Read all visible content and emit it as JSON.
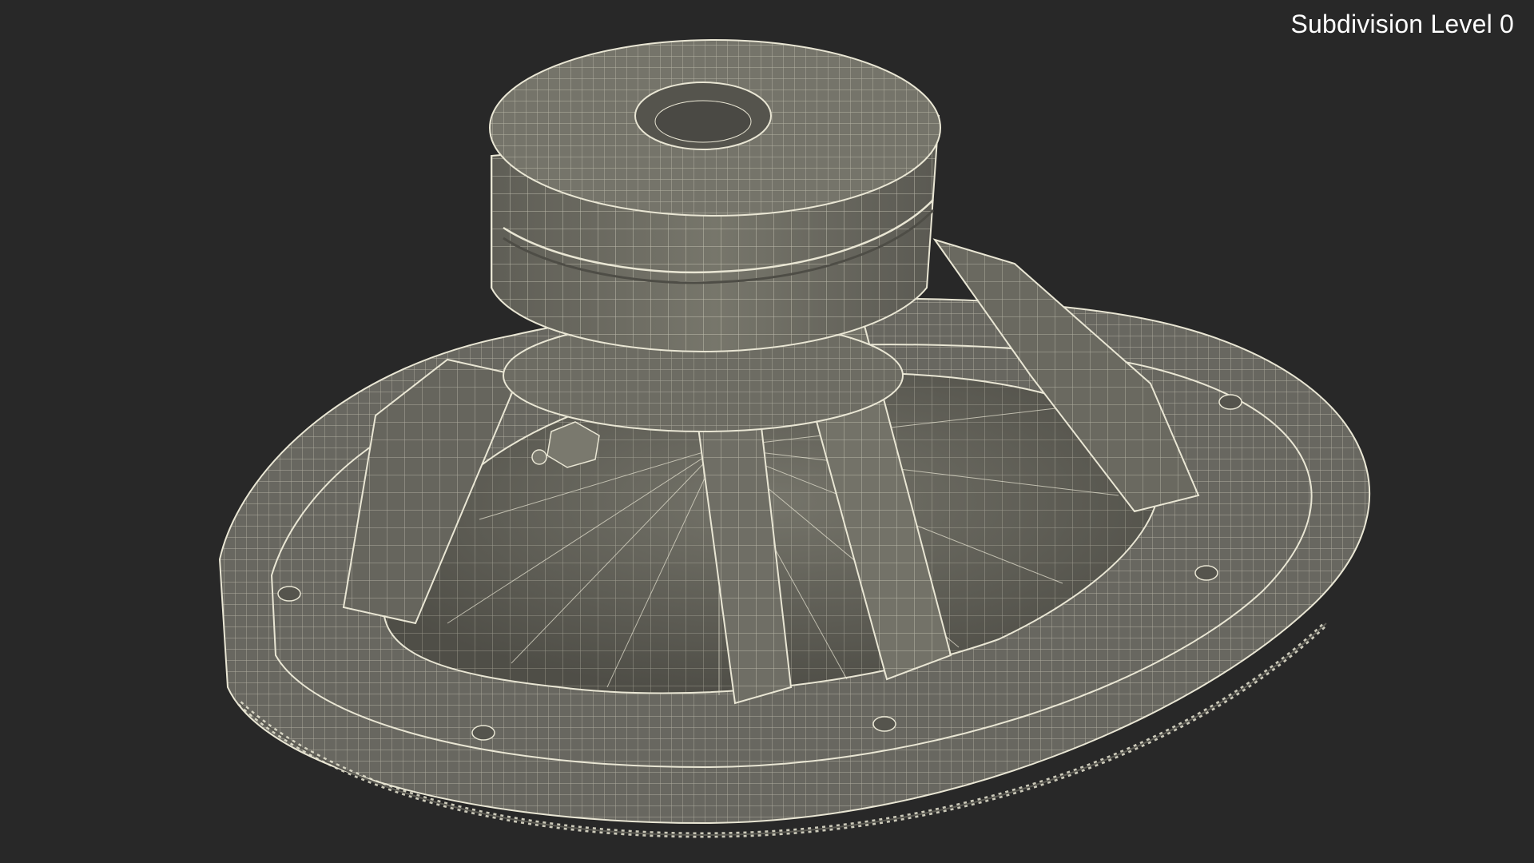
{
  "viewport": {
    "overlay_label": "Subdivision Level 0",
    "background_color": "#282828",
    "mesh_fill_color": "#6b6a60",
    "mesh_shadow_color": "#4e4d46",
    "wire_color": "#e9e6d4"
  },
  "model": {
    "subject": "speaker-woofer-wireframe",
    "render_mode": "wireframe-on-shaded"
  }
}
